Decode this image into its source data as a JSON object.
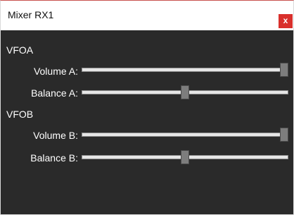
{
  "window": {
    "title": "Mixer RX1",
    "close_label": "x"
  },
  "groups": [
    {
      "label": "VFOA",
      "controls": [
        {
          "label": "Volume A:",
          "value": 1.0
        },
        {
          "label": "Balance A:",
          "value": 0.5
        }
      ]
    },
    {
      "label": "VFOB",
      "controls": [
        {
          "label": "Volume B:",
          "value": 1.0
        },
        {
          "label": "Balance B:",
          "value": 0.5
        }
      ]
    }
  ],
  "colors": {
    "background": "#2a2a2a",
    "close_button": "#d9302c",
    "text": "#ffffff"
  },
  "icons": {
    "close": "close-icon"
  }
}
